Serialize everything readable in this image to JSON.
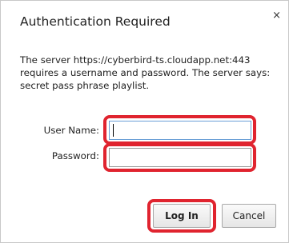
{
  "dialog": {
    "title": "Authentication Required",
    "close_glyph": "×",
    "message_lines": [
      "The server https://cyberbird-ts.cloudapp.net:443",
      "requires a username and password. The server says:",
      "secret pass phrase playlist."
    ]
  },
  "form": {
    "username_label": "User Name:",
    "username_value": "",
    "password_label": "Password:",
    "password_value": ""
  },
  "buttons": {
    "login_label": "Log In",
    "cancel_label": "Cancel"
  },
  "colors": {
    "highlight": "#e0242f",
    "focus_border": "#6a9fd6"
  }
}
